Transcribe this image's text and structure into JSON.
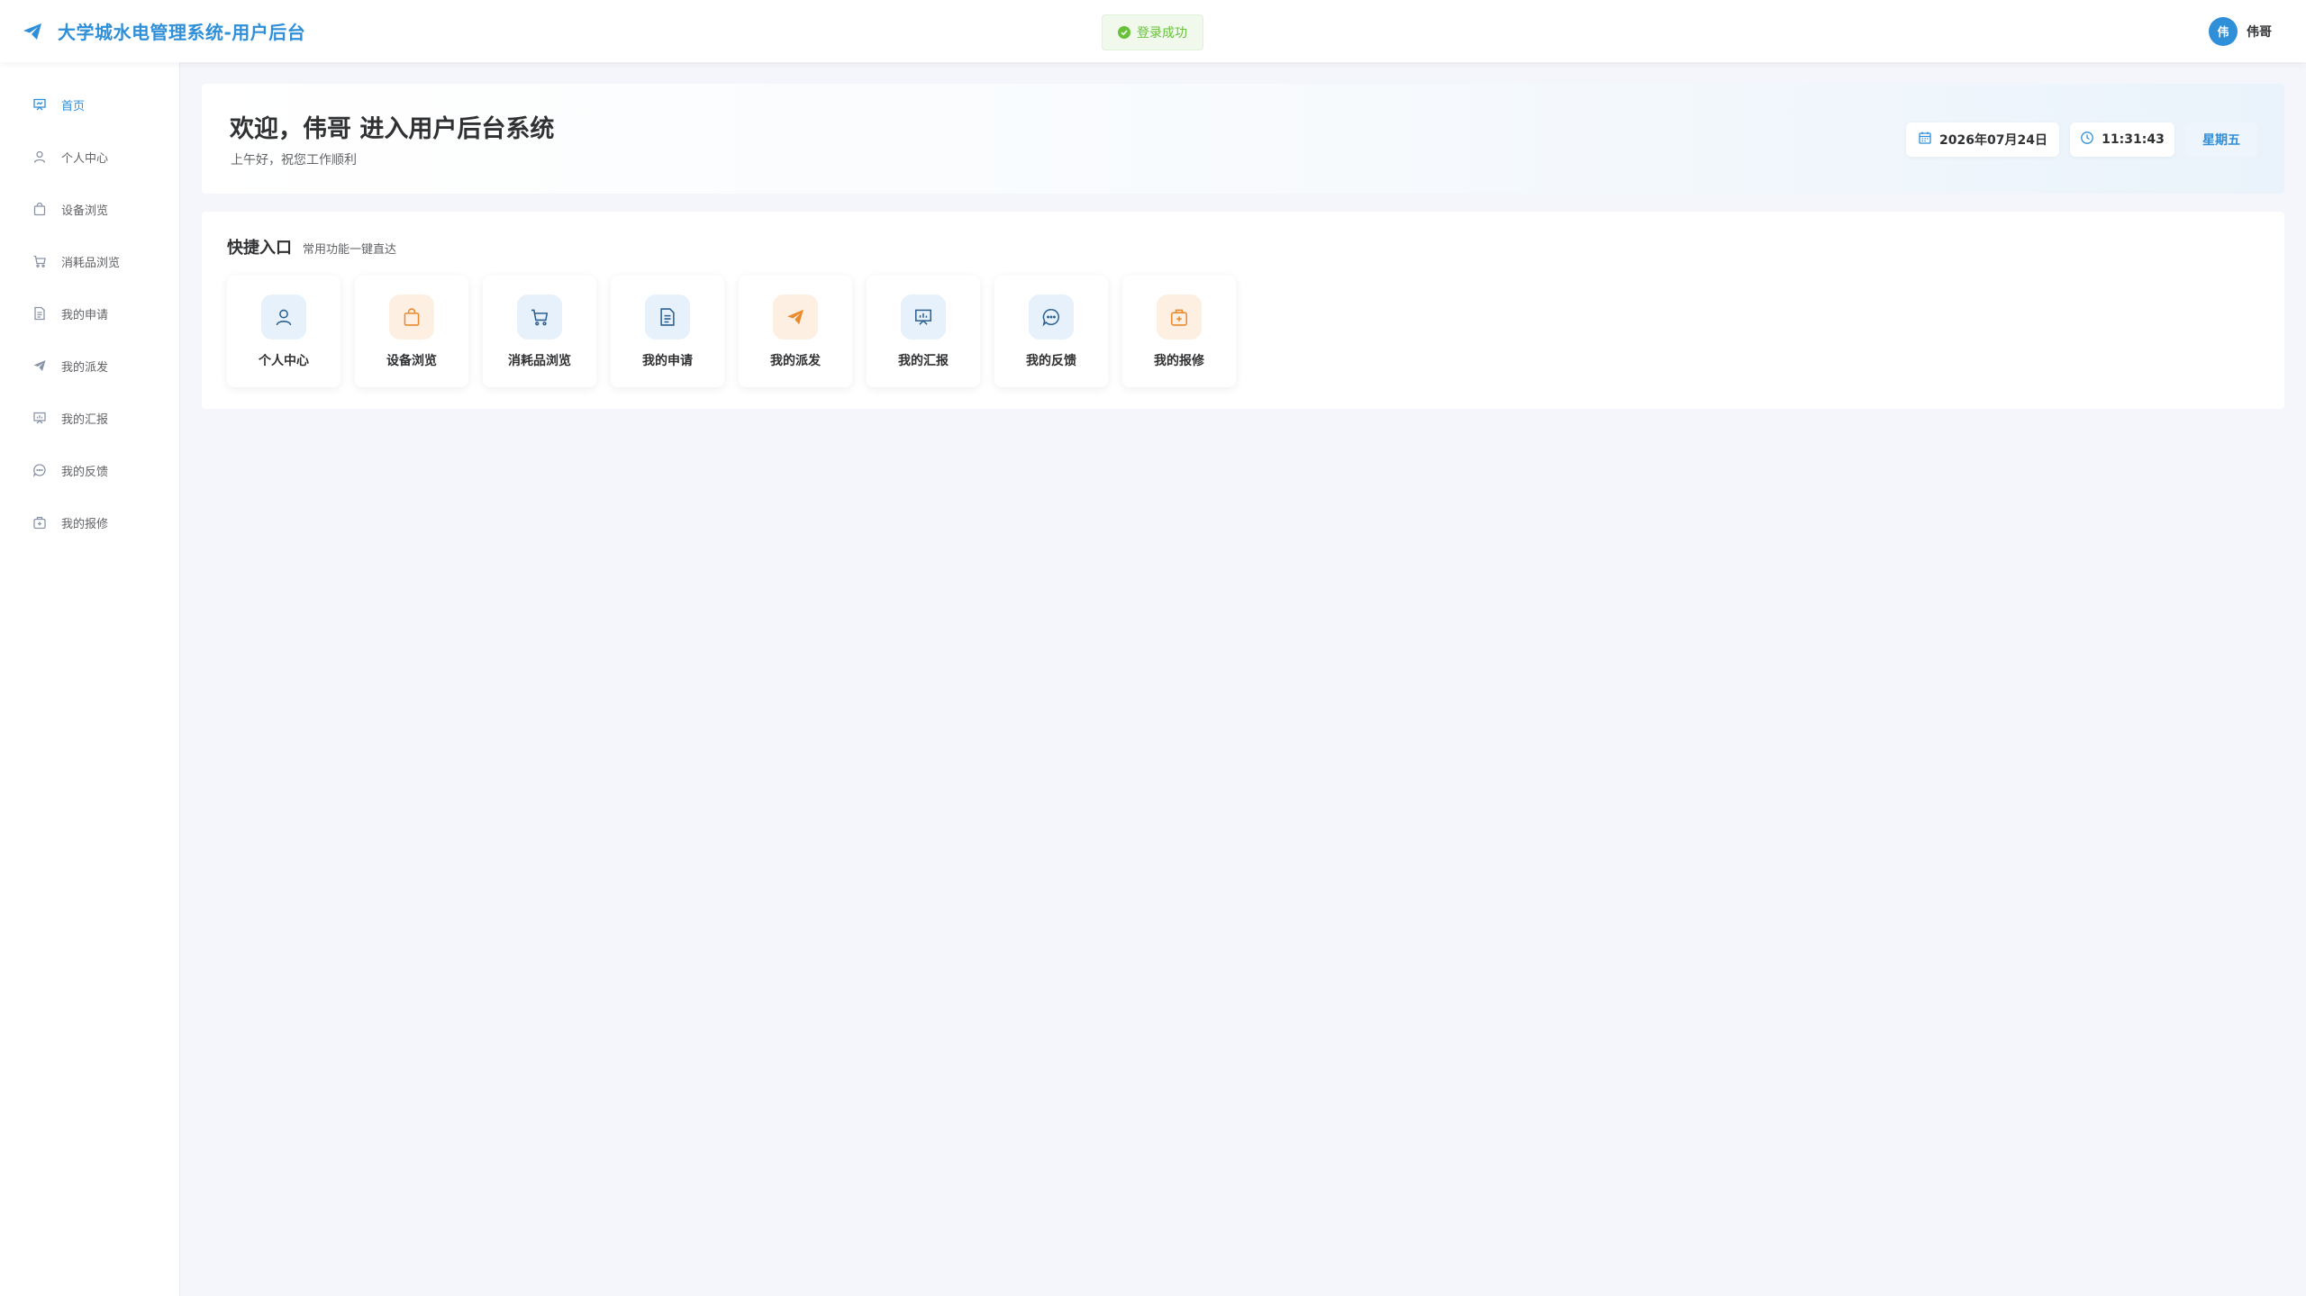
{
  "header": {
    "app_title": "大学城水电管理系统-用户后台",
    "toast": "登录成功",
    "avatar_initial": "伟",
    "user_name": "伟哥"
  },
  "sidebar": {
    "items": [
      {
        "label": "首页",
        "icon": "home-icon",
        "active": true
      },
      {
        "label": "个人中心",
        "icon": "user-icon"
      },
      {
        "label": "设备浏览",
        "icon": "bag-icon"
      },
      {
        "label": "消耗品浏览",
        "icon": "cart-icon"
      },
      {
        "label": "我的申请",
        "icon": "document-icon"
      },
      {
        "label": "我的派发",
        "icon": "send-icon"
      },
      {
        "label": "我的汇报",
        "icon": "presentation-icon"
      },
      {
        "label": "我的反馈",
        "icon": "chat-icon"
      },
      {
        "label": "我的报修",
        "icon": "medical-box-icon"
      }
    ]
  },
  "welcome": {
    "title": "欢迎，伟哥 进入用户后台系统",
    "subtitle": "上午好，祝您工作顺利",
    "date": "2026年07月24日",
    "time": "11:31:43",
    "weekday": "星期五"
  },
  "quick": {
    "title": "快捷入口",
    "subtitle": "常用功能一键直达",
    "items": [
      {
        "label": "个人中心",
        "icon": "user-icon",
        "tone": "blue"
      },
      {
        "label": "设备浏览",
        "icon": "bag-icon",
        "tone": "orange"
      },
      {
        "label": "消耗品浏览",
        "icon": "cart-icon",
        "tone": "blue"
      },
      {
        "label": "我的申请",
        "icon": "document-icon",
        "tone": "blue"
      },
      {
        "label": "我的派发",
        "icon": "send-icon",
        "tone": "orange"
      },
      {
        "label": "我的汇报",
        "icon": "presentation-icon",
        "tone": "blue"
      },
      {
        "label": "我的反馈",
        "icon": "chat-icon",
        "tone": "blue"
      },
      {
        "label": "我的报修",
        "icon": "medical-box-icon",
        "tone": "orange"
      }
    ]
  },
  "colors": {
    "primary": "#2f8fd8",
    "accent_orange": "#e98a2e",
    "success": "#67c23a",
    "background": "#f4f6fb"
  }
}
